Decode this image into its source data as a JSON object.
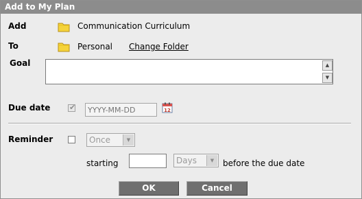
{
  "dialog": {
    "title": "Add to My Plan",
    "add": {
      "label": "Add",
      "value": "Communication Curriculum",
      "icon": "folder-icon"
    },
    "to": {
      "label": "To",
      "value": "Personal",
      "change_link": "Change Folder",
      "icon": "folder-icon"
    },
    "goal": {
      "label": "Goal",
      "value": ""
    },
    "due_date": {
      "label": "Due date",
      "checked": true,
      "disabled": true,
      "placeholder": "YYYY-MM-DD",
      "icon": "calendar-icon",
      "calendar_day": "12"
    },
    "reminder": {
      "label": "Reminder",
      "checked": false,
      "frequency": "Once",
      "starting_label": "starting",
      "starting_value": "",
      "unit": "Days",
      "suffix": "before the due date"
    },
    "buttons": {
      "ok": "OK",
      "cancel": "Cancel"
    }
  }
}
